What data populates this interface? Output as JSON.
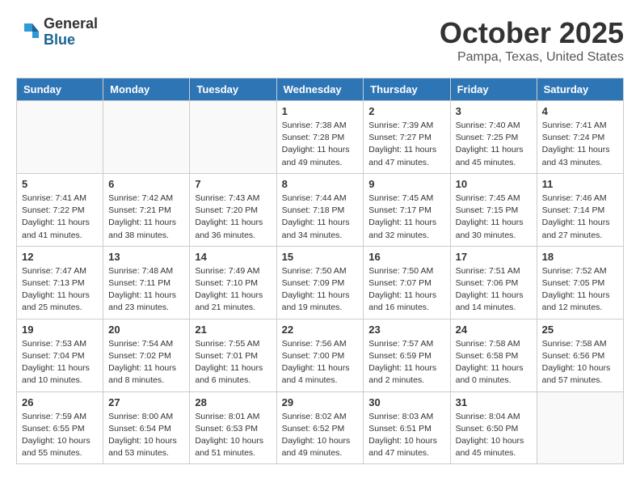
{
  "header": {
    "logo_general": "General",
    "logo_blue": "Blue",
    "month": "October 2025",
    "location": "Pampa, Texas, United States"
  },
  "weekdays": [
    "Sunday",
    "Monday",
    "Tuesday",
    "Wednesday",
    "Thursday",
    "Friday",
    "Saturday"
  ],
  "weeks": [
    [
      {
        "day": "",
        "info": ""
      },
      {
        "day": "",
        "info": ""
      },
      {
        "day": "",
        "info": ""
      },
      {
        "day": "1",
        "info": "Sunrise: 7:38 AM\nSunset: 7:28 PM\nDaylight: 11 hours and 49 minutes."
      },
      {
        "day": "2",
        "info": "Sunrise: 7:39 AM\nSunset: 7:27 PM\nDaylight: 11 hours and 47 minutes."
      },
      {
        "day": "3",
        "info": "Sunrise: 7:40 AM\nSunset: 7:25 PM\nDaylight: 11 hours and 45 minutes."
      },
      {
        "day": "4",
        "info": "Sunrise: 7:41 AM\nSunset: 7:24 PM\nDaylight: 11 hours and 43 minutes."
      }
    ],
    [
      {
        "day": "5",
        "info": "Sunrise: 7:41 AM\nSunset: 7:22 PM\nDaylight: 11 hours and 41 minutes."
      },
      {
        "day": "6",
        "info": "Sunrise: 7:42 AM\nSunset: 7:21 PM\nDaylight: 11 hours and 38 minutes."
      },
      {
        "day": "7",
        "info": "Sunrise: 7:43 AM\nSunset: 7:20 PM\nDaylight: 11 hours and 36 minutes."
      },
      {
        "day": "8",
        "info": "Sunrise: 7:44 AM\nSunset: 7:18 PM\nDaylight: 11 hours and 34 minutes."
      },
      {
        "day": "9",
        "info": "Sunrise: 7:45 AM\nSunset: 7:17 PM\nDaylight: 11 hours and 32 minutes."
      },
      {
        "day": "10",
        "info": "Sunrise: 7:45 AM\nSunset: 7:15 PM\nDaylight: 11 hours and 30 minutes."
      },
      {
        "day": "11",
        "info": "Sunrise: 7:46 AM\nSunset: 7:14 PM\nDaylight: 11 hours and 27 minutes."
      }
    ],
    [
      {
        "day": "12",
        "info": "Sunrise: 7:47 AM\nSunset: 7:13 PM\nDaylight: 11 hours and 25 minutes."
      },
      {
        "day": "13",
        "info": "Sunrise: 7:48 AM\nSunset: 7:11 PM\nDaylight: 11 hours and 23 minutes."
      },
      {
        "day": "14",
        "info": "Sunrise: 7:49 AM\nSunset: 7:10 PM\nDaylight: 11 hours and 21 minutes."
      },
      {
        "day": "15",
        "info": "Sunrise: 7:50 AM\nSunset: 7:09 PM\nDaylight: 11 hours and 19 minutes."
      },
      {
        "day": "16",
        "info": "Sunrise: 7:50 AM\nSunset: 7:07 PM\nDaylight: 11 hours and 16 minutes."
      },
      {
        "day": "17",
        "info": "Sunrise: 7:51 AM\nSunset: 7:06 PM\nDaylight: 11 hours and 14 minutes."
      },
      {
        "day": "18",
        "info": "Sunrise: 7:52 AM\nSunset: 7:05 PM\nDaylight: 11 hours and 12 minutes."
      }
    ],
    [
      {
        "day": "19",
        "info": "Sunrise: 7:53 AM\nSunset: 7:04 PM\nDaylight: 11 hours and 10 minutes."
      },
      {
        "day": "20",
        "info": "Sunrise: 7:54 AM\nSunset: 7:02 PM\nDaylight: 11 hours and 8 minutes."
      },
      {
        "day": "21",
        "info": "Sunrise: 7:55 AM\nSunset: 7:01 PM\nDaylight: 11 hours and 6 minutes."
      },
      {
        "day": "22",
        "info": "Sunrise: 7:56 AM\nSunset: 7:00 PM\nDaylight: 11 hours and 4 minutes."
      },
      {
        "day": "23",
        "info": "Sunrise: 7:57 AM\nSunset: 6:59 PM\nDaylight: 11 hours and 2 minutes."
      },
      {
        "day": "24",
        "info": "Sunrise: 7:58 AM\nSunset: 6:58 PM\nDaylight: 11 hours and 0 minutes."
      },
      {
        "day": "25",
        "info": "Sunrise: 7:58 AM\nSunset: 6:56 PM\nDaylight: 10 hours and 57 minutes."
      }
    ],
    [
      {
        "day": "26",
        "info": "Sunrise: 7:59 AM\nSunset: 6:55 PM\nDaylight: 10 hours and 55 minutes."
      },
      {
        "day": "27",
        "info": "Sunrise: 8:00 AM\nSunset: 6:54 PM\nDaylight: 10 hours and 53 minutes."
      },
      {
        "day": "28",
        "info": "Sunrise: 8:01 AM\nSunset: 6:53 PM\nDaylight: 10 hours and 51 minutes."
      },
      {
        "day": "29",
        "info": "Sunrise: 8:02 AM\nSunset: 6:52 PM\nDaylight: 10 hours and 49 minutes."
      },
      {
        "day": "30",
        "info": "Sunrise: 8:03 AM\nSunset: 6:51 PM\nDaylight: 10 hours and 47 minutes."
      },
      {
        "day": "31",
        "info": "Sunrise: 8:04 AM\nSunset: 6:50 PM\nDaylight: 10 hours and 45 minutes."
      },
      {
        "day": "",
        "info": ""
      }
    ]
  ]
}
